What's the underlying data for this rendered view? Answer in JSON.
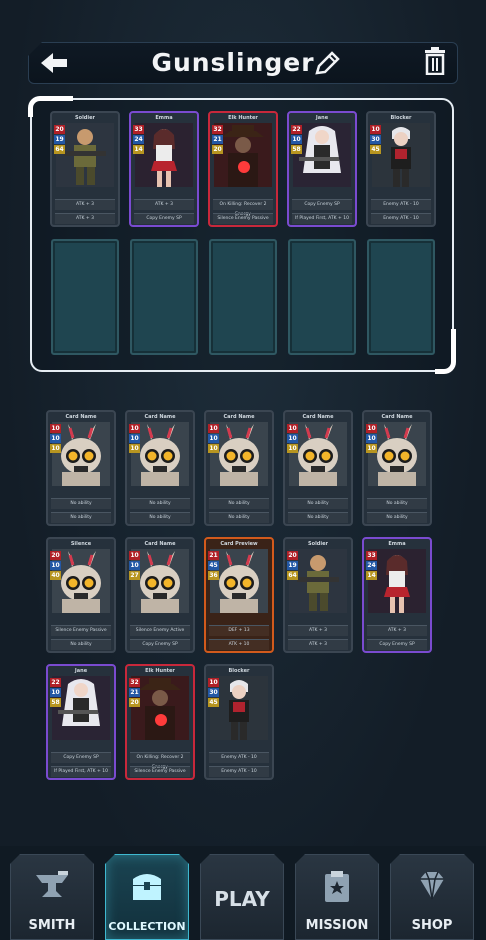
{
  "header": {
    "title": "Gunslinger"
  },
  "deck": [
    {
      "name": "Soldier",
      "atk": "20",
      "hp": "19",
      "cost": "64",
      "ability1": "ATK + 3",
      "ability2": "ATK + 3",
      "rarity": "common",
      "art": "soldier"
    },
    {
      "name": "Emma",
      "atk": "33",
      "hp": "24",
      "cost": "14",
      "ability1": "ATK + 3",
      "ability2": "Copy Enemy SP",
      "rarity": "epic",
      "art": "girl"
    },
    {
      "name": "Elk Hunter",
      "atk": "32",
      "hp": "21",
      "cost": "20",
      "ability1": "On Killing: Recover 2 Energy",
      "ability2": "Silence Enemy Passive",
      "rarity": "rare",
      "art": "hunter"
    },
    {
      "name": "Jane",
      "atk": "22",
      "hp": "10",
      "cost": "58",
      "ability1": "Copy Enemy SP",
      "ability2": "If Played First, ATK + 10",
      "rarity": "epic",
      "art": "jane"
    },
    {
      "name": "Blocker",
      "atk": "10",
      "hp": "30",
      "cost": "45",
      "ability1": "Enemy ATK - 10",
      "ability2": "Enemy ATK - 10",
      "rarity": "common",
      "art": "blocker"
    }
  ],
  "collection": [
    {
      "name": "Card Name",
      "atk": "10",
      "hp": "10",
      "cost": "10",
      "ability1": "No ability",
      "ability2": "No ability",
      "rarity": "common",
      "art": "skull"
    },
    {
      "name": "Card Name",
      "atk": "10",
      "hp": "10",
      "cost": "10",
      "ability1": "No ability",
      "ability2": "No ability",
      "rarity": "common",
      "art": "skull"
    },
    {
      "name": "Card Name",
      "atk": "10",
      "hp": "10",
      "cost": "10",
      "ability1": "No ability",
      "ability2": "No ability",
      "rarity": "common",
      "art": "skull"
    },
    {
      "name": "Card Name",
      "atk": "10",
      "hp": "10",
      "cost": "10",
      "ability1": "No ability",
      "ability2": "No ability",
      "rarity": "common",
      "art": "skull"
    },
    {
      "name": "Card Name",
      "atk": "10",
      "hp": "10",
      "cost": "10",
      "ability1": "No ability",
      "ability2": "No ability",
      "rarity": "common",
      "art": "skull"
    },
    {
      "name": "Silence",
      "atk": "20",
      "hp": "10",
      "cost": "40",
      "ability1": "Silence Enemy Passive",
      "ability2": "No ability",
      "rarity": "common",
      "art": "skull"
    },
    {
      "name": "Card Name",
      "atk": "10",
      "hp": "10",
      "cost": "27",
      "ability1": "Silence Enemy Active",
      "ability2": "Copy Enemy SP",
      "rarity": "common",
      "art": "skull"
    },
    {
      "name": "Card Preview",
      "atk": "21",
      "hp": "45",
      "cost": "36",
      "ability1": "DEF + 13",
      "ability2": "ATK + 10",
      "rarity": "orange",
      "art": "skull"
    },
    {
      "name": "Soldier",
      "atk": "20",
      "hp": "19",
      "cost": "64",
      "ability1": "ATK + 3",
      "ability2": "ATK + 3",
      "rarity": "common",
      "art": "soldier"
    },
    {
      "name": "Emma",
      "atk": "33",
      "hp": "24",
      "cost": "14",
      "ability1": "ATK + 3",
      "ability2": "Copy Enemy SP",
      "rarity": "epic",
      "art": "girl"
    },
    {
      "name": "Jane",
      "atk": "22",
      "hp": "10",
      "cost": "58",
      "ability1": "Copy Enemy SP",
      "ability2": "If Played First, ATK + 10",
      "rarity": "epic",
      "art": "jane"
    },
    {
      "name": "Elk Hunter",
      "atk": "32",
      "hp": "21",
      "cost": "20",
      "ability1": "On Killing: Recover 2 Energy",
      "ability2": "Silence Enemy Passive",
      "rarity": "rare",
      "art": "hunter"
    },
    {
      "name": "Blocker",
      "atk": "10",
      "hp": "30",
      "cost": "45",
      "ability1": "Enemy ATK - 10",
      "ability2": "Enemy ATK - 10",
      "rarity": "common",
      "art": "blocker"
    }
  ],
  "nav": {
    "smith": "SMITH",
    "collection": "COLLECTION",
    "play": "PLAY",
    "mission": "MISSION",
    "shop": "SHOP"
  }
}
